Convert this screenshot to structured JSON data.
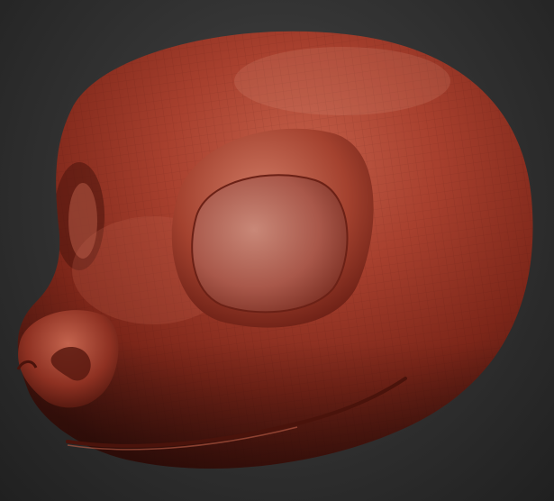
{
  "viewport": {
    "subject": "sculpted-creature-head",
    "material_color": "#9c3a2a",
    "highlight_color": "#d4806a",
    "shadow_color": "#3e120c",
    "background_color": "#2b2b2b"
  }
}
